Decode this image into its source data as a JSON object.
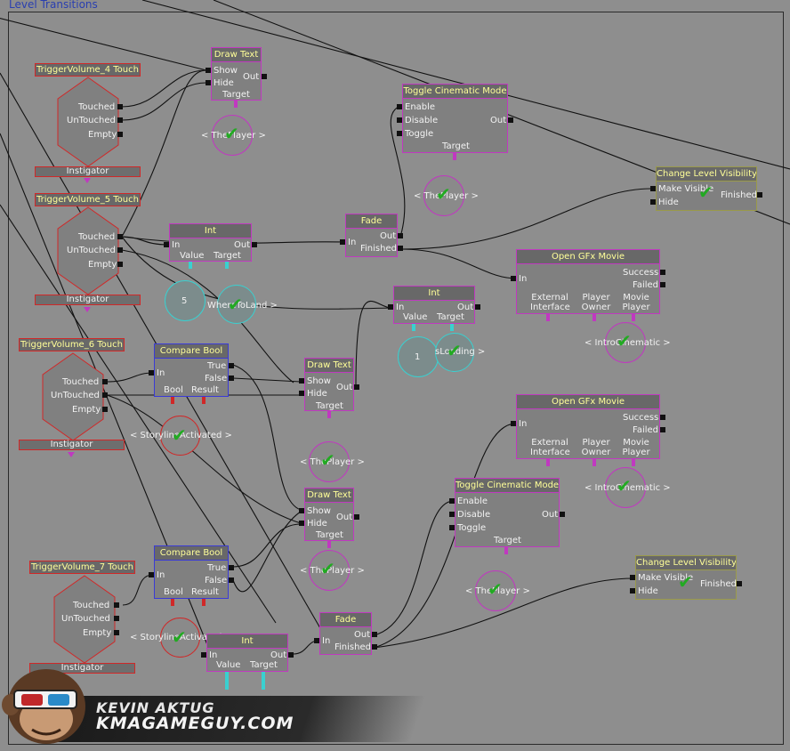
{
  "window": {
    "title": "Level Transitions"
  },
  "colors": {
    "canvas": "#8e8e8e",
    "node_border": "#c039c0",
    "title_text": "#ffff99",
    "link_port": "#c039c0",
    "int_port": "#3ad0d0",
    "bool_port": "#d02828",
    "check": "#22aa22"
  },
  "triggers": [
    {
      "title": "TriggerVolume_4 Touch",
      "outputs": [
        "Touched",
        "UnTouched",
        "Empty"
      ],
      "footer": "Instigator"
    },
    {
      "title": "TriggerVolume_5 Touch",
      "outputs": [
        "Touched",
        "UnTouched",
        "Empty"
      ],
      "footer": "Instigator"
    },
    {
      "title": "TriggerVolume_6 Touch",
      "outputs": [
        "Touched",
        "UnTouched",
        "Empty"
      ],
      "footer": "Instigator"
    },
    {
      "title": "TriggerVolume_7 Touch",
      "outputs": [
        "Touched",
        "UnTouched",
        "Empty"
      ],
      "footer": "Instigator"
    }
  ],
  "draw_text": [
    {
      "title": "Draw Text",
      "inputs": [
        "Show",
        "Hide"
      ],
      "output": "Out",
      "var": "Target",
      "target": "< ThePlayer >"
    },
    {
      "title": "Draw Text",
      "inputs": [
        "Show",
        "Hide"
      ],
      "output": "Out",
      "var": "Target",
      "target": "< ThePlayer >"
    },
    {
      "title": "Draw Text",
      "inputs": [
        "Show",
        "Hide"
      ],
      "output": "Out",
      "var": "Target",
      "target": "< ThePlayer >"
    }
  ],
  "toggle_cinematic": [
    {
      "title": "Toggle Cinematic Mode",
      "inputs": [
        "Enable",
        "Disable",
        "Toggle"
      ],
      "output": "Out",
      "var": "Target",
      "target": "< ThePlayer >"
    },
    {
      "title": "Toggle Cinematic Mode",
      "inputs": [
        "Enable",
        "Disable",
        "Toggle"
      ],
      "output": "Out",
      "var": "Target",
      "target": "< ThePlayer >"
    }
  ],
  "change_level": [
    {
      "title": "Change Level Visibility",
      "inputs": [
        "Make Visible",
        "Hide"
      ],
      "output": "Finished"
    },
    {
      "title": "Change Level Visibility",
      "inputs": [
        "Make Visible",
        "Hide"
      ],
      "output": "Finished"
    }
  ],
  "fade": [
    {
      "title": "Fade",
      "input": "In",
      "outputs": [
        "Out",
        "Finished"
      ]
    },
    {
      "title": "Fade",
      "input": "In",
      "outputs": [
        "Out",
        "Finished"
      ]
    }
  ],
  "int_nodes": [
    {
      "title": "Int",
      "input": "In",
      "output": "Out",
      "vars": [
        "Value",
        "Target"
      ],
      "value": "5",
      "target": "WhereToLand >"
    },
    {
      "title": "Int",
      "input": "In",
      "output": "Out",
      "vars": [
        "Value",
        "Target"
      ],
      "value": "1",
      "target": "sLoading >"
    },
    {
      "title": "Int",
      "input": "In",
      "output": "Out",
      "vars": [
        "Value",
        "Target"
      ]
    }
  ],
  "gfx_movie": [
    {
      "title": "Open GFx Movie",
      "input": "In",
      "outputs": [
        "Success",
        "Failed"
      ],
      "vars": [
        "External Interface",
        "Player Owner",
        "Movie Player"
      ],
      "target": "< IntroCinematic >"
    },
    {
      "title": "Open GFx Movie",
      "input": "In",
      "outputs": [
        "Success",
        "Failed"
      ],
      "vars": [
        "External Interface",
        "Player Owner",
        "Movie Player"
      ],
      "target": "< IntroCinematic >"
    }
  ],
  "compare_bool": [
    {
      "title": "Compare Bool",
      "input": "In",
      "outputs": [
        "True",
        "False"
      ],
      "vars": [
        "Bool",
        "Result"
      ],
      "var_label": "< StorylineActivated >"
    },
    {
      "title": "Compare Bool",
      "input": "In",
      "outputs": [
        "True",
        "False"
      ],
      "vars": [
        "Bool",
        "Result"
      ],
      "var_label": "< StorylineActivated >"
    }
  ],
  "watermark": {
    "line1": "KEVIN AKTUG",
    "line2": "KMAGAMEGUY.COM"
  }
}
